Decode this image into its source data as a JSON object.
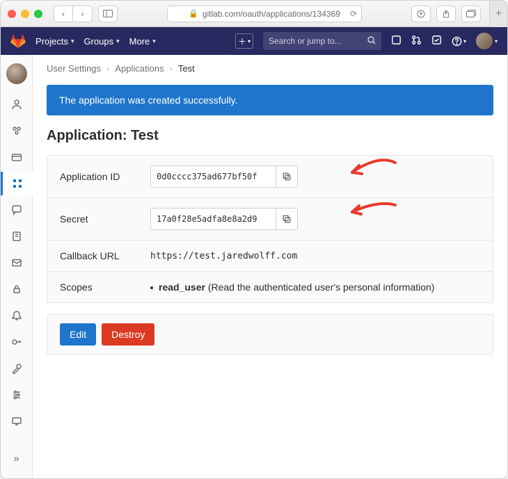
{
  "browser": {
    "url": "gitlab.com/oauth/applications/134369"
  },
  "nav": {
    "projects": "Projects",
    "groups": "Groups",
    "more": "More",
    "search_placeholder": "Search or jump to..."
  },
  "breadcrumbs": {
    "root": "User Settings",
    "section": "Applications",
    "current": "Test"
  },
  "alert": {
    "message": "The application was created successfully."
  },
  "page": {
    "title": "Application: Test"
  },
  "fields": {
    "app_id_label": "Application ID",
    "app_id_value": "0d0cccc375ad677bf50f",
    "secret_label": "Secret",
    "secret_value": "17a0f28e5adfa8e8a2d9",
    "callback_label": "Callback URL",
    "callback_value": "https://test.jaredwolff.com",
    "scopes_label": "Scopes",
    "scope_name": "read_user",
    "scope_desc": " (Read the authenticated user's personal information)"
  },
  "buttons": {
    "edit": "Edit",
    "destroy": "Destroy"
  },
  "colors": {
    "nav_bg": "#292961",
    "primary": "#1f75cb",
    "danger": "#db3b21"
  }
}
